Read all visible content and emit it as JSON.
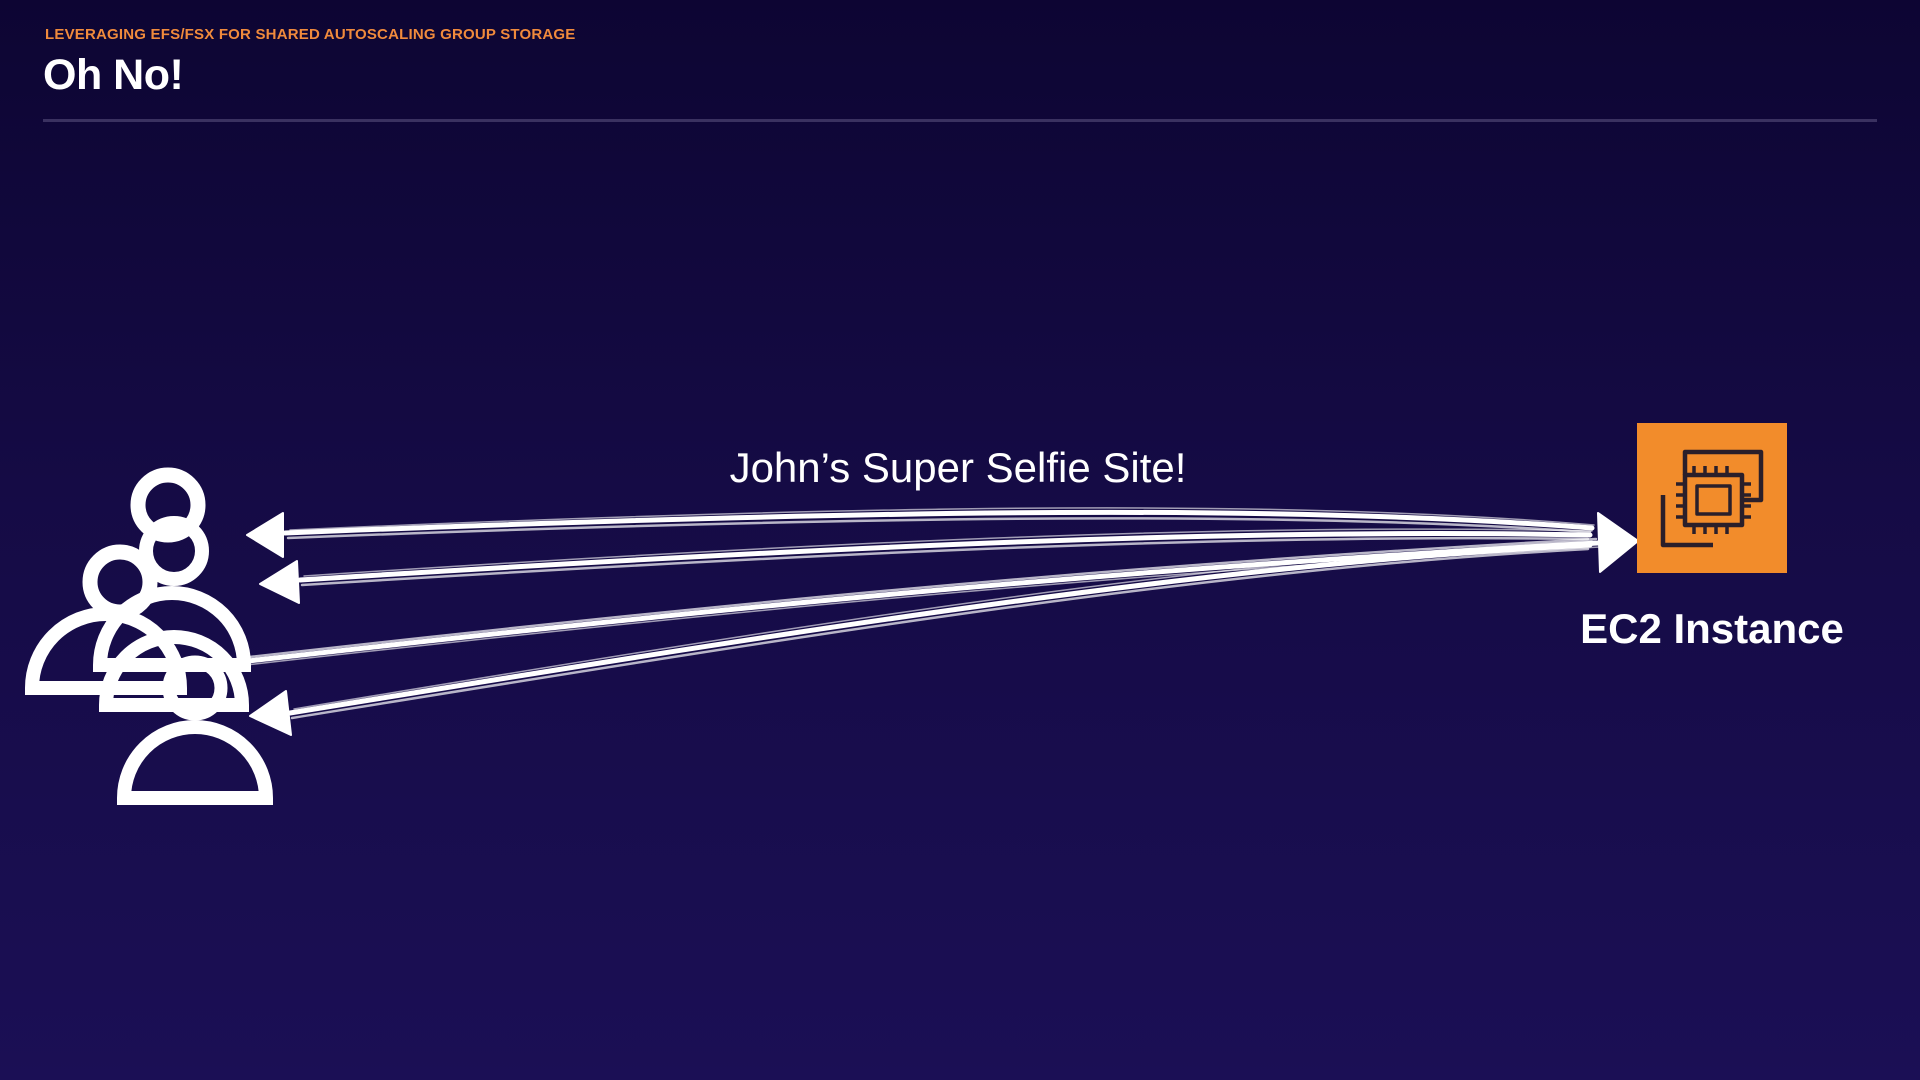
{
  "header": {
    "eyebrow": "LEVERAGING EFS/FSX FOR SHARED AUTOSCALING GROUP STORAGE",
    "title": "Oh No!"
  },
  "diagram": {
    "site_label": "John’s Super Selfie Site!",
    "server_label": "EC2 Instance",
    "server_icon": "ec2-chip-icon",
    "user_icon": "user-icon",
    "colors": {
      "accent": "#f08a3c",
      "ec2_orange": "#f28c2b",
      "arrow": "#ffffff",
      "background_top": "#0d0533",
      "background_bottom": "#1b0f55"
    }
  }
}
